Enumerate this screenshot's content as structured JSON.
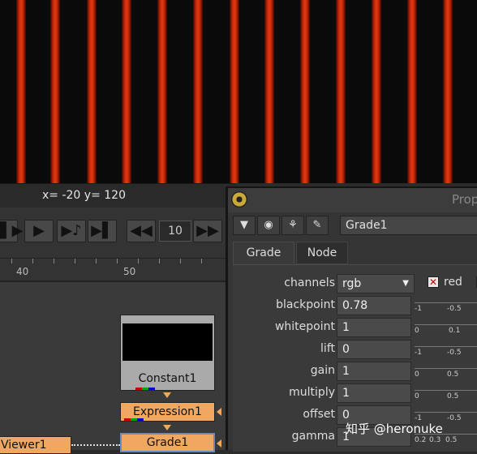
{
  "viewer": {
    "coords": "x= -20 y= 120"
  },
  "transport": {
    "buttons": [
      "prev-keyframe",
      "play",
      "next-keyframe-step",
      "last-frame",
      "rewind",
      "forward"
    ],
    "frame": "10"
  },
  "timeline": {
    "labels": [
      "40",
      "50"
    ]
  },
  "nodes": {
    "constant": "Constant1",
    "expression": "Expression1",
    "grade": "Grade1",
    "viewer": "Viewer1"
  },
  "panel": {
    "title": "Prop",
    "node_name": "Grade1",
    "tabs": [
      "Grade",
      "Node"
    ],
    "rows": [
      {
        "label": "channels",
        "value": "rgb"
      },
      {
        "label": "blackpoint",
        "value": "0.78"
      },
      {
        "label": "whitepoint",
        "value": "1"
      },
      {
        "label": "lift",
        "value": "0"
      },
      {
        "label": "gain",
        "value": "1"
      },
      {
        "label": "multiply",
        "value": "1"
      },
      {
        "label": "offset",
        "value": "0"
      },
      {
        "label": "gamma",
        "value": "1"
      }
    ],
    "red_label": "red"
  },
  "watermark": "知乎 @heronuke",
  "colors": {
    "accent_orange": "#f0a860",
    "red_stripe": "#d8300c"
  }
}
